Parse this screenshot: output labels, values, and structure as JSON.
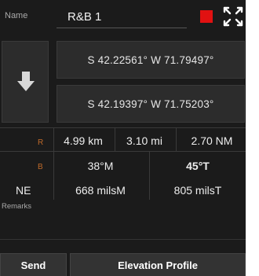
{
  "header": {
    "name_label": "Name",
    "name_value": "R&B 1",
    "color_swatch": "#e11111",
    "close_icon": "close-icon"
  },
  "coordinates": {
    "direction_icon": "arrow-down-icon",
    "start": "S 42.22561°  W 71.79497°",
    "end": "S 42.19397°  W 71.75203°"
  },
  "range": {
    "label": "R",
    "km": "4.99 km",
    "mi": "3.10 mi",
    "nm": "2.70 NM"
  },
  "bearing": {
    "label": "B",
    "magnetic": "38°M",
    "true": "45°T",
    "cardinal": "NE",
    "mils_magnetic": "668 milsM",
    "mils_true": "805 milsT"
  },
  "remarks_label": "Remarks",
  "buttons": {
    "send": "Send",
    "elevation": "Elevation Profile"
  }
}
